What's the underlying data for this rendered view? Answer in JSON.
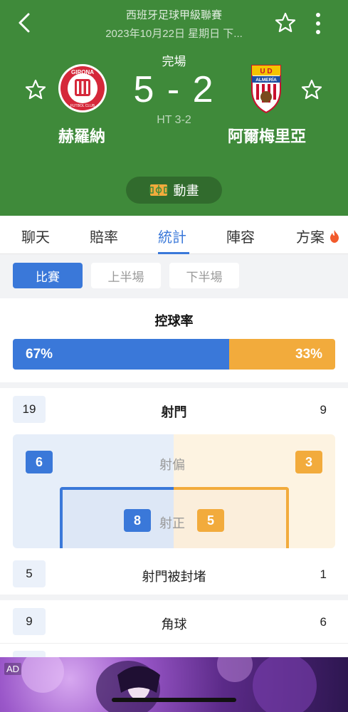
{
  "header": {
    "league": "西班牙足球甲級聯賽",
    "datetime": "2023年10月22日 星期日 下...",
    "status": "完場",
    "score": "5 - 2",
    "halftime": "HT 3-2",
    "home_team": "赫羅納",
    "away_team": "阿爾梅里亞",
    "home_logo_text": "GIRONA",
    "home_logo_subtext": "FUTBOL CLUB",
    "away_logo_text": "ALMERÍA",
    "away_logo_letters": "U D",
    "animation_label": "動畫",
    "color": "#3f8a3a"
  },
  "tabs": [
    {
      "label": "聊天"
    },
    {
      "label": "賠率"
    },
    {
      "label": "統計",
      "active": true
    },
    {
      "label": "陣容"
    },
    {
      "label": "方案",
      "icon": "fire-icon"
    }
  ],
  "segments": [
    {
      "label": "比賽",
      "active": true
    },
    {
      "label": "上半場"
    },
    {
      "label": "下半場"
    }
  ],
  "possession": {
    "title": "控球率",
    "home": "67%",
    "away": "33%",
    "home_value": 67,
    "away_value": 33,
    "home_color": "#3a78d9",
    "away_color": "#f2ab3c"
  },
  "shots": {
    "label": "射門",
    "home": "19",
    "away": "9",
    "off_target_label": "射偏",
    "off_target_home": "6",
    "off_target_away": "3",
    "on_target_label": "射正",
    "on_target_home": "8",
    "on_target_away": "5"
  },
  "blocked": {
    "label": "射門被封堵",
    "home": "5",
    "away": "1"
  },
  "corners": {
    "label": "角球",
    "home": "9",
    "away": "6"
  },
  "ad": {
    "label": "AD"
  }
}
